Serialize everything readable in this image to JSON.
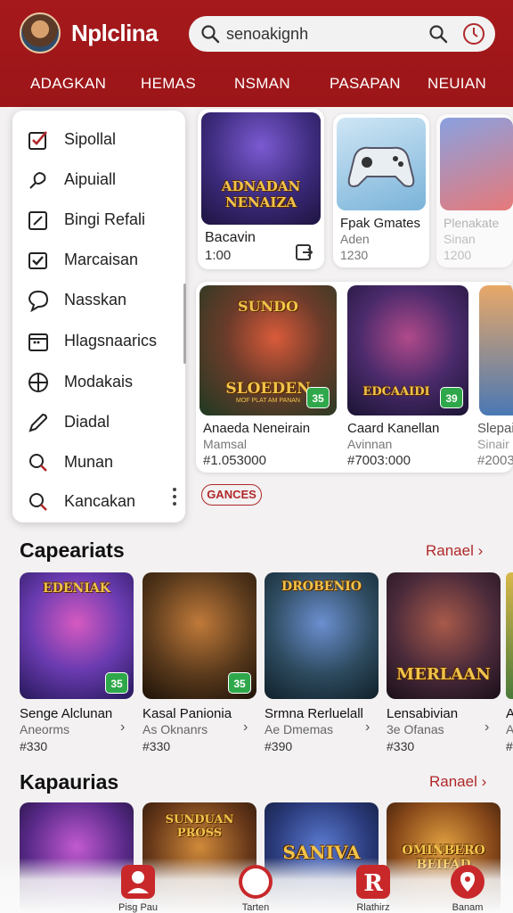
{
  "header": {
    "app_title": "Nplclina",
    "search_text": "senoakignh",
    "categories": [
      "ADAGKAN",
      "HEMAS",
      "NSMAN",
      "PASAPAN",
      "NEUIAN"
    ]
  },
  "menu": {
    "items": [
      {
        "label": "Sipollal",
        "icon": "checkbox-icon"
      },
      {
        "label": "Aipuiall",
        "icon": "pin-icon"
      },
      {
        "label": "Bingi Refali",
        "icon": "edit-box-icon"
      },
      {
        "label": "Marcaisan",
        "icon": "check-box-icon"
      },
      {
        "label": "Nasskan",
        "icon": "chat-icon"
      },
      {
        "label": "Hlagsnaarics",
        "icon": "calendar-icon"
      },
      {
        "label": "Modakais",
        "icon": "plus-circle-icon"
      },
      {
        "label": "Diadal",
        "icon": "pen-icon"
      },
      {
        "label": "Munan",
        "icon": "search-icon"
      },
      {
        "label": "Kancakan",
        "icon": "search-icon"
      }
    ]
  },
  "featured_top": [
    {
      "art_title_1": "ADNADAN",
      "art_title_2": "NENAIZA",
      "title": "Bacavin",
      "price": "1:00"
    },
    {
      "title": "Fpak Gmates",
      "sub": "Aden",
      "price": "1230"
    },
    {
      "title": "Plenakate",
      "sub": "Sinan",
      "price": "1200"
    }
  ],
  "featured_mid": [
    {
      "art_title_1": "SUNDO",
      "art_title_2": "SLOEDEN",
      "art_sub": "MOF PLAT AM PANAN",
      "badge": "35",
      "title": "Anaeda Neneirain",
      "sub": "Mamsal",
      "price": "#1.053000"
    },
    {
      "art_title": "EDCAAIDI",
      "badge": "39",
      "title": "Caard Kanellan",
      "sub": "Avinnan",
      "price": "#7003:000"
    },
    {
      "title": "Slepair",
      "sub": "Sinair",
      "price": "#2003"
    }
  ],
  "chip": "GANCES",
  "sections": [
    {
      "title": "Capeariats",
      "see_all": "Ranael",
      "games": [
        {
          "art": "EDENIAK",
          "badge": "35",
          "title": "Senge Alclunan",
          "sub": "Aneorms",
          "price": "#330"
        },
        {
          "art": "",
          "badge": "35",
          "title": "Kasal Panionia",
          "sub": "As Oknanrs",
          "price": "#330"
        },
        {
          "art": "DROBENIO",
          "badge": "",
          "title": "Srmna Rerluelall",
          "sub": "Ae Dmemas",
          "price": "#390"
        },
        {
          "art": "MERLAAN",
          "badge": "",
          "title": "Lensabivian",
          "sub": "3e Ofanas",
          "price": "#330"
        },
        {
          "art": "",
          "badge": "",
          "title": "A",
          "sub": "A",
          "price": "#"
        }
      ]
    },
    {
      "title": "Kapaurias",
      "see_all": "Ranael",
      "games": [
        {
          "art": ""
        },
        {
          "art": "SUNDUAN PROSS"
        },
        {
          "art": "SANIVA"
        },
        {
          "art": "OMINBERO BEIFAD"
        }
      ]
    }
  ],
  "bottom_nav": [
    {
      "label": "Pisg Pau",
      "icon": "user-icon"
    },
    {
      "label": "Tarten",
      "icon": "compass-icon"
    },
    {
      "label": "Rlathirz",
      "icon": "r-logo-icon"
    },
    {
      "label": "Banam",
      "icon": "location-icon"
    }
  ],
  "colors": {
    "brand": "#9f171a",
    "accent": "#b0282a",
    "badge": "#2ea84a"
  }
}
